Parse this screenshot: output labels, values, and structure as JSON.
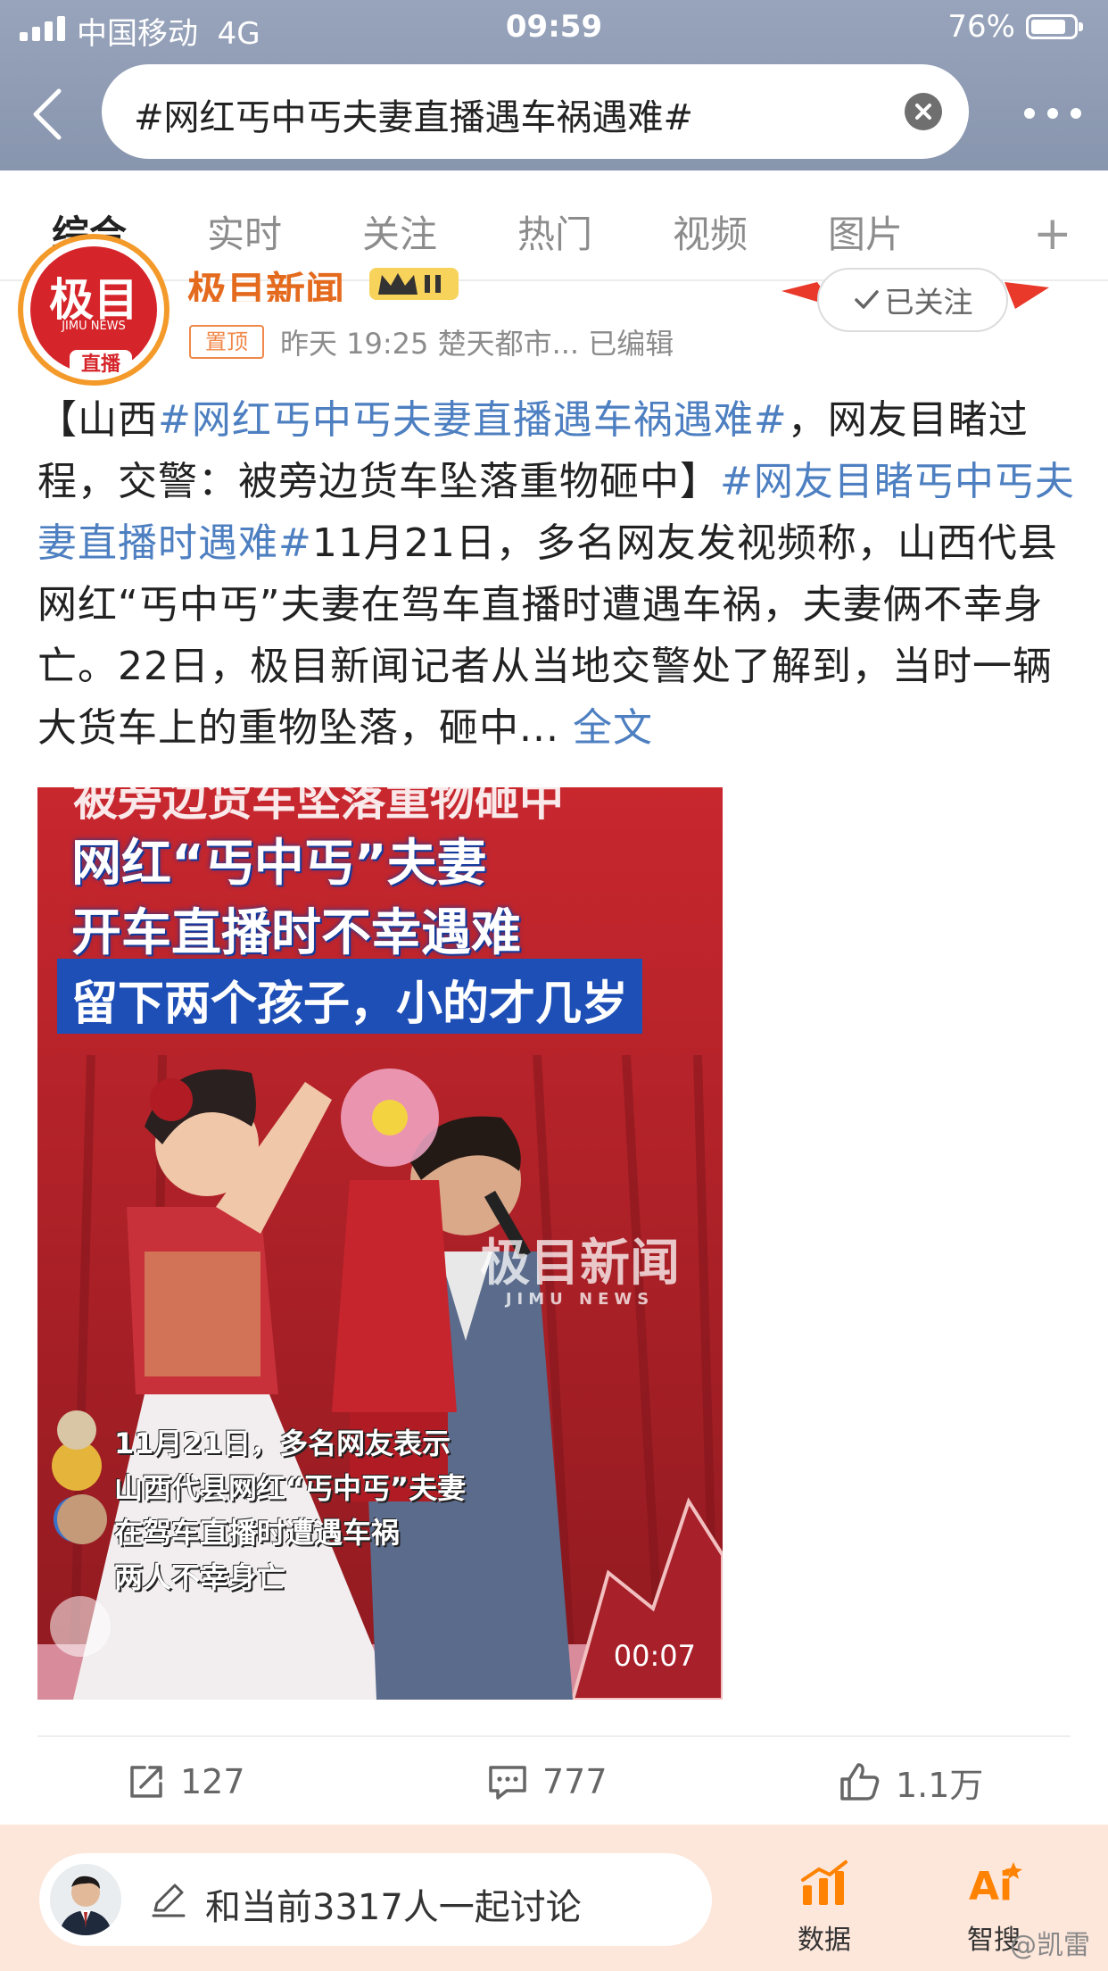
{
  "status": {
    "carrier": "中国移动",
    "network": "4G",
    "time": "09:59",
    "battery": "76%"
  },
  "search": {
    "query": "#网红丐中丐夫妻直播遇车祸遇难#"
  },
  "tabs": [
    {
      "label": "综合"
    },
    {
      "label": "实时"
    },
    {
      "label": "关注"
    },
    {
      "label": "热门"
    },
    {
      "label": "视频"
    },
    {
      "label": "图片"
    }
  ],
  "tab_add": "+",
  "post": {
    "author": "极目新闻",
    "avatar_logo": "极目",
    "avatar_sub": "JIMU NEWS",
    "avatar_badge": "直播",
    "pin_label": "置顶",
    "meta": "昨天 19:25  楚天都市...  已编辑",
    "follow_label": "已关注",
    "text": {
      "p1": "【山西",
      "tag1": "#网红丐中丐夫妻直播遇车祸遇难#",
      "p2": "，网友目睹过程，交警：被旁边货车坠落重物砸中】",
      "tag2": "#网友目睹丐中丐夫妻直播时遇难#",
      "p3": "11月21日，多名网友发视频称，山西代县网红“丐中丐”夫妻在驾车直播时遭遇车祸，夫妻俩不幸身亡。22日，极目新闻记者从当地交警处了解到，当时一辆大货车上的重物坠落，砸中...",
      "full": "全文"
    }
  },
  "video": {
    "caption_top": "被旁边货车坠落重物砸中",
    "caption_1": "网红“丐中丐”夫妻",
    "caption_2": "开车直播时不幸遇难",
    "caption_3": "留下两个孩子，小的才几岁",
    "watermark": "极目新闻",
    "watermark_sub": "JIMU NEWS",
    "subtitles": [
      "11月21日，多名网友表示",
      "山西代县网红“丐中丐”夫妻",
      "在驾车直播时遭遇车祸",
      "两人不幸身亡"
    ],
    "duration": "00:07"
  },
  "actions": {
    "reposts": "127",
    "comments": "777",
    "likes": "1.1万"
  },
  "bottom": {
    "compose_text": "和当前3317人一起讨论",
    "data_label": "数据",
    "smart_label": "智搜",
    "credit": "@凯雷"
  },
  "colors": {
    "header_bg": "#8e9ab2",
    "accent_orange": "#ff8200",
    "link_blue": "#4d7fc1",
    "bottom_bg": "#fde6da"
  }
}
